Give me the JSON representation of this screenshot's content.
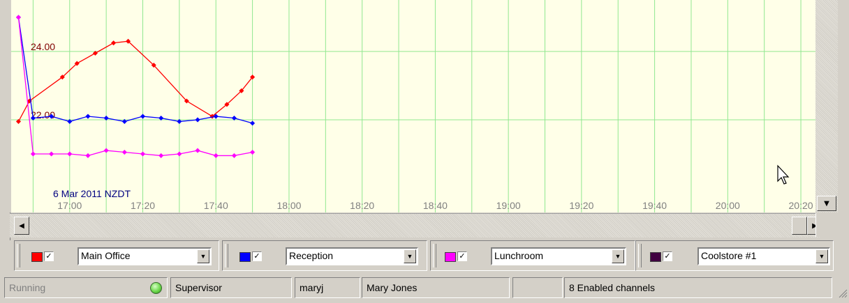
{
  "chart": {
    "date_label": "6 Mar 2011 NZDT",
    "y_ticks": [
      "24.00",
      "22.00"
    ],
    "x_ticks": [
      "17:00",
      "17:20",
      "17:40",
      "18:00",
      "18:20",
      "18:40",
      "19:00",
      "19:20",
      "19:40",
      "20:00",
      "20:20"
    ],
    "background": "#ffffe8",
    "grid_color": "#90e890"
  },
  "chart_data": {
    "type": "line",
    "x_unit": "time (hh:mm)",
    "xlim": [
      "16:44",
      "20:24"
    ],
    "ylim": [
      20.0,
      25.1
    ],
    "series": [
      {
        "color": "#ff0000",
        "x": [
          "16:46",
          "16:49",
          "16:58",
          "17:02",
          "17:07",
          "17:12",
          "17:16",
          "17:23",
          "17:32",
          "17:39",
          "17:43",
          "17:47",
          "17:50"
        ],
        "values": [
          21.95,
          22.55,
          23.25,
          23.65,
          23.95,
          24.25,
          24.3,
          23.6,
          22.55,
          22.1,
          22.45,
          22.85,
          23.25
        ]
      },
      {
        "color": "#0000ff",
        "x": [
          "16:46",
          "16:50",
          "16:55",
          "17:00",
          "17:05",
          "17:10",
          "17:15",
          "17:20",
          "17:25",
          "17:30",
          "17:35",
          "17:40",
          "17:45",
          "17:50"
        ],
        "values": [
          25.0,
          22.05,
          22.1,
          21.95,
          22.1,
          22.05,
          21.95,
          22.1,
          22.05,
          21.95,
          22.0,
          22.1,
          22.05,
          21.9
        ]
      },
      {
        "color": "#ff00ff",
        "x": [
          "16:46",
          "16:50",
          "16:55",
          "17:00",
          "17:05",
          "17:10",
          "17:15",
          "17:20",
          "17:25",
          "17:30",
          "17:35",
          "17:40",
          "17:45",
          "17:50"
        ],
        "values": [
          25.0,
          21.0,
          21.0,
          21.0,
          20.95,
          21.1,
          21.05,
          21.0,
          20.95,
          21.0,
          21.1,
          20.95,
          20.95,
          21.05
        ]
      }
    ]
  },
  "scrollbars": {
    "down_arrow": "▼",
    "left_arrow": "◀",
    "right_arrow": "▶"
  },
  "channels": [
    {
      "color": "#ff0000",
      "checked": "✓",
      "name": "Main Office"
    },
    {
      "color": "#0000ff",
      "checked": "✓",
      "name": "Reception"
    },
    {
      "color": "#ff00ff",
      "checked": "✓",
      "name": "Lunchroom"
    },
    {
      "color": "#400040",
      "checked": "✓",
      "name": "Coolstore #1"
    }
  ],
  "dropdown_arrow": "▼",
  "status": {
    "state": "Running",
    "role": "Supervisor",
    "username": "maryj",
    "fullname": "Mary Jones",
    "blank": "",
    "channels": "8 Enabled channels"
  }
}
